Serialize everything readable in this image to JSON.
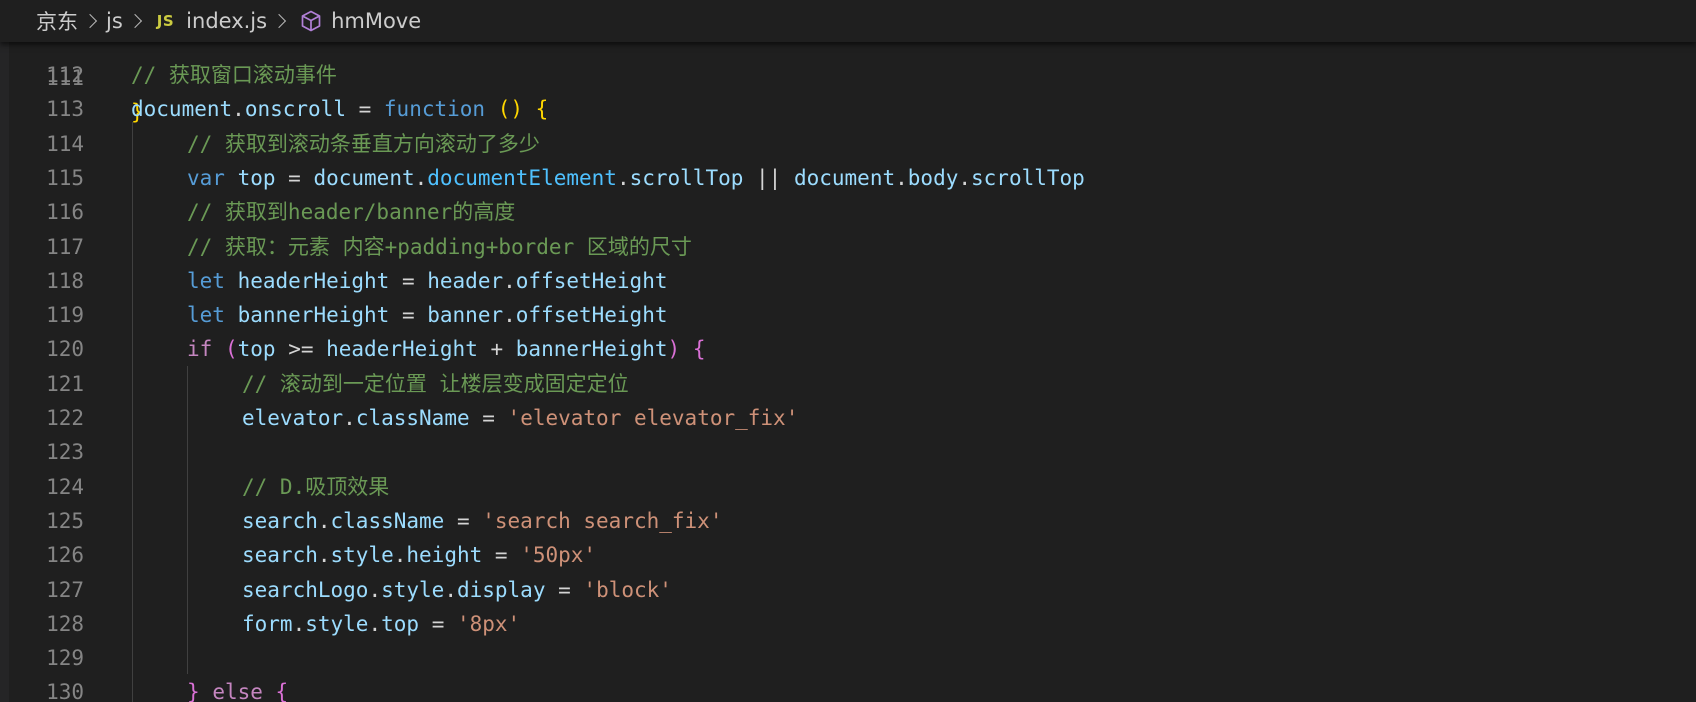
{
  "breadcrumb": {
    "folder": "京东",
    "subfolder": "js",
    "file_icon": "JS",
    "file": "index.js",
    "symbol": "hmMove",
    "symbol_icon": "method-cube-icon"
  },
  "editor": {
    "partial_top_line": {
      "number": "111",
      "text": "}"
    },
    "lines": [
      {
        "number": "112",
        "tokens": [
          {
            "t": "// 获取窗口滚动事件",
            "c": "comment"
          }
        ]
      },
      {
        "number": "113",
        "tokens": [
          {
            "t": "document",
            "c": "var"
          },
          {
            "t": ".",
            "c": "op"
          },
          {
            "t": "onscroll",
            "c": "var"
          },
          {
            "t": " = ",
            "c": "op"
          },
          {
            "t": "function",
            "c": "key"
          },
          {
            "t": " ",
            "c": "op"
          },
          {
            "t": "()",
            "c": "b1"
          },
          {
            "t": " ",
            "c": "op"
          },
          {
            "t": "{",
            "c": "b1"
          }
        ]
      },
      {
        "number": "114",
        "tokens": [
          {
            "t": "// 获取到滚动条垂直方向滚动了多少",
            "c": "comment"
          }
        ]
      },
      {
        "number": "115",
        "tokens": [
          {
            "t": "var",
            "c": "key"
          },
          {
            "t": " ",
            "c": "op"
          },
          {
            "t": "top",
            "c": "var"
          },
          {
            "t": " = ",
            "c": "op"
          },
          {
            "t": "document",
            "c": "var"
          },
          {
            "t": ".",
            "c": "op"
          },
          {
            "t": "documentElement",
            "c": "propfn"
          },
          {
            "t": ".",
            "c": "op"
          },
          {
            "t": "scrollTop",
            "c": "var"
          },
          {
            "t": " || ",
            "c": "op"
          },
          {
            "t": "document",
            "c": "var"
          },
          {
            "t": ".",
            "c": "op"
          },
          {
            "t": "body",
            "c": "var"
          },
          {
            "t": ".",
            "c": "op"
          },
          {
            "t": "scrollTop",
            "c": "var"
          }
        ]
      },
      {
        "number": "116",
        "tokens": [
          {
            "t": "// 获取到header/banner的高度",
            "c": "comment"
          }
        ]
      },
      {
        "number": "117",
        "tokens": [
          {
            "t": "// 获取：元素 内容+padding+border 区域的尺寸",
            "c": "comment"
          }
        ]
      },
      {
        "number": "118",
        "tokens": [
          {
            "t": "let",
            "c": "key"
          },
          {
            "t": " ",
            "c": "op"
          },
          {
            "t": "headerHeight",
            "c": "var"
          },
          {
            "t": " = ",
            "c": "op"
          },
          {
            "t": "header",
            "c": "var"
          },
          {
            "t": ".",
            "c": "op"
          },
          {
            "t": "offsetHeight",
            "c": "var"
          }
        ]
      },
      {
        "number": "119",
        "tokens": [
          {
            "t": "let",
            "c": "key"
          },
          {
            "t": " ",
            "c": "op"
          },
          {
            "t": "bannerHeight",
            "c": "var"
          },
          {
            "t": " = ",
            "c": "op"
          },
          {
            "t": "banner",
            "c": "var"
          },
          {
            "t": ".",
            "c": "op"
          },
          {
            "t": "offsetHeight",
            "c": "var"
          }
        ]
      },
      {
        "number": "120",
        "tokens": [
          {
            "t": "if",
            "c": "ctrl"
          },
          {
            "t": " ",
            "c": "op"
          },
          {
            "t": "(",
            "c": "b2"
          },
          {
            "t": "top",
            "c": "var"
          },
          {
            "t": " >= ",
            "c": "op"
          },
          {
            "t": "headerHeight",
            "c": "var"
          },
          {
            "t": " + ",
            "c": "op"
          },
          {
            "t": "bannerHeight",
            "c": "var"
          },
          {
            "t": ")",
            "c": "b2"
          },
          {
            "t": " ",
            "c": "op"
          },
          {
            "t": "{",
            "c": "b2"
          }
        ]
      },
      {
        "number": "121",
        "tokens": [
          {
            "t": "// 滚动到一定位置 让楼层变成固定定位",
            "c": "comment"
          }
        ]
      },
      {
        "number": "122",
        "tokens": [
          {
            "t": "elevator",
            "c": "var"
          },
          {
            "t": ".",
            "c": "op"
          },
          {
            "t": "className",
            "c": "var"
          },
          {
            "t": " = ",
            "c": "op"
          },
          {
            "t": "'elevator elevator_fix'",
            "c": "str"
          }
        ]
      },
      {
        "number": "123",
        "tokens": []
      },
      {
        "number": "124",
        "tokens": [
          {
            "t": "// D.吸顶效果",
            "c": "comment"
          }
        ]
      },
      {
        "number": "125",
        "tokens": [
          {
            "t": "search",
            "c": "var"
          },
          {
            "t": ".",
            "c": "op"
          },
          {
            "t": "className",
            "c": "var"
          },
          {
            "t": " = ",
            "c": "op"
          },
          {
            "t": "'search search_fix'",
            "c": "str"
          }
        ]
      },
      {
        "number": "126",
        "tokens": [
          {
            "t": "search",
            "c": "var"
          },
          {
            "t": ".",
            "c": "op"
          },
          {
            "t": "style",
            "c": "var"
          },
          {
            "t": ".",
            "c": "op"
          },
          {
            "t": "height",
            "c": "var"
          },
          {
            "t": " = ",
            "c": "op"
          },
          {
            "t": "'50px'",
            "c": "str"
          }
        ]
      },
      {
        "number": "127",
        "tokens": [
          {
            "t": "searchLogo",
            "c": "var"
          },
          {
            "t": ".",
            "c": "op"
          },
          {
            "t": "style",
            "c": "var"
          },
          {
            "t": ".",
            "c": "op"
          },
          {
            "t": "display",
            "c": "var"
          },
          {
            "t": " = ",
            "c": "op"
          },
          {
            "t": "'block'",
            "c": "str"
          }
        ]
      },
      {
        "number": "128",
        "tokens": [
          {
            "t": "form",
            "c": "var"
          },
          {
            "t": ".",
            "c": "op"
          },
          {
            "t": "style",
            "c": "var"
          },
          {
            "t": ".",
            "c": "op"
          },
          {
            "t": "top",
            "c": "var"
          },
          {
            "t": " = ",
            "c": "op"
          },
          {
            "t": "'8px'",
            "c": "str"
          }
        ]
      },
      {
        "number": "129",
        "tokens": []
      },
      {
        "number": "130",
        "tokens": [
          {
            "t": "}",
            "c": "b2"
          },
          {
            "t": " ",
            "c": "op"
          },
          {
            "t": "else",
            "c": "ctrl"
          },
          {
            "t": " ",
            "c": "op"
          },
          {
            "t": "{",
            "c": "b2"
          }
        ]
      }
    ]
  },
  "colors": {
    "background": "#1f1f1f",
    "comment": "#6a9955",
    "variable": "#9cdcfe",
    "keyword": "#569cd6",
    "control": "#c586c0",
    "string": "#ce9178",
    "bracket_level1": "#ffd700",
    "bracket_level2": "#da70d6",
    "line_number": "#858585"
  }
}
